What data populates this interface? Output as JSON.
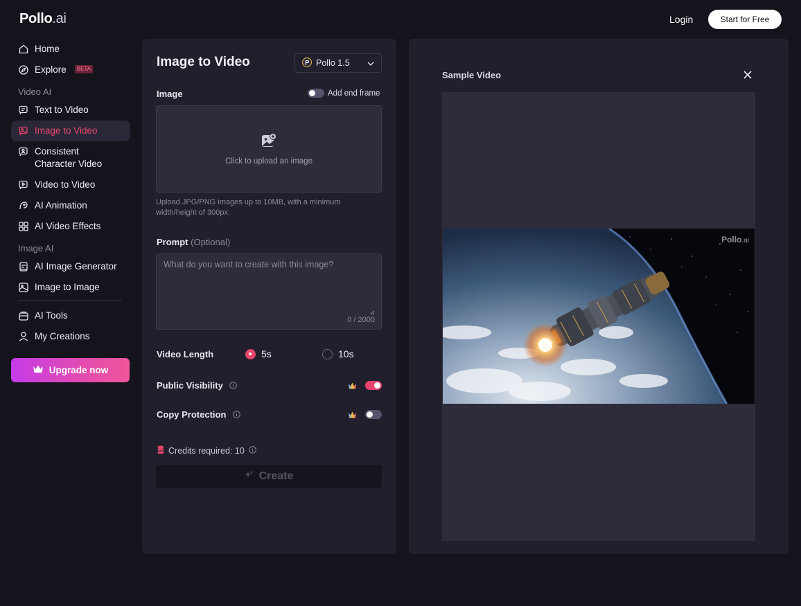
{
  "header": {
    "logo_main": "Pollo",
    "logo_suffix": ".ai",
    "login_label": "Login",
    "start_label": "Start for Free"
  },
  "sidebar": {
    "home": "Home",
    "explore": "Explore",
    "explore_badge": "BETA",
    "section_video": "Video AI",
    "text_to_video": "Text to Video",
    "image_to_video": "Image to Video",
    "consistent_line1": "Consistent",
    "consistent_line2": "Character Video",
    "video_to_video": "Video to Video",
    "ai_animation": "AI Animation",
    "ai_video_effects": "AI Video Effects",
    "section_image": "Image AI",
    "ai_image_generator": "AI Image Generator",
    "image_to_image": "Image to Image",
    "ai_tools": "AI Tools",
    "my_creations": "My Creations",
    "upgrade_label": "Upgrade now"
  },
  "form": {
    "title": "Image to Video",
    "model": "Pollo 1.5",
    "image_label": "Image",
    "add_end_frame": "Add end frame",
    "add_end_frame_on": false,
    "upload_text": "Click to upload an image",
    "upload_hint": "Upload JPG/PNG images up to 10MB, with a minimum width/height of 300px.",
    "prompt_label": "Prompt",
    "prompt_optional": "(Optional)",
    "prompt_placeholder": "What do you want to create with this image?",
    "prompt_value": "",
    "prompt_counter": "0 / 2000",
    "video_length_label": "Video Length",
    "length_options": [
      "5s",
      "10s"
    ],
    "length_selected": "5s",
    "public_visibility_label": "Public Visibility",
    "public_visibility_on": true,
    "copy_protection_label": "Copy Protection",
    "copy_protection_on": false,
    "credits_text": "Credits required: 10",
    "create_label": "Create"
  },
  "preview": {
    "title": "Sample Video",
    "watermark_main": "Pollo",
    "watermark_suffix": ".ai"
  },
  "colors": {
    "accent": "#e8456e",
    "background": "#15141d",
    "panel": "#211f2c",
    "upgrade_gradient": [
      "#c43ce8",
      "#f0569a"
    ]
  }
}
